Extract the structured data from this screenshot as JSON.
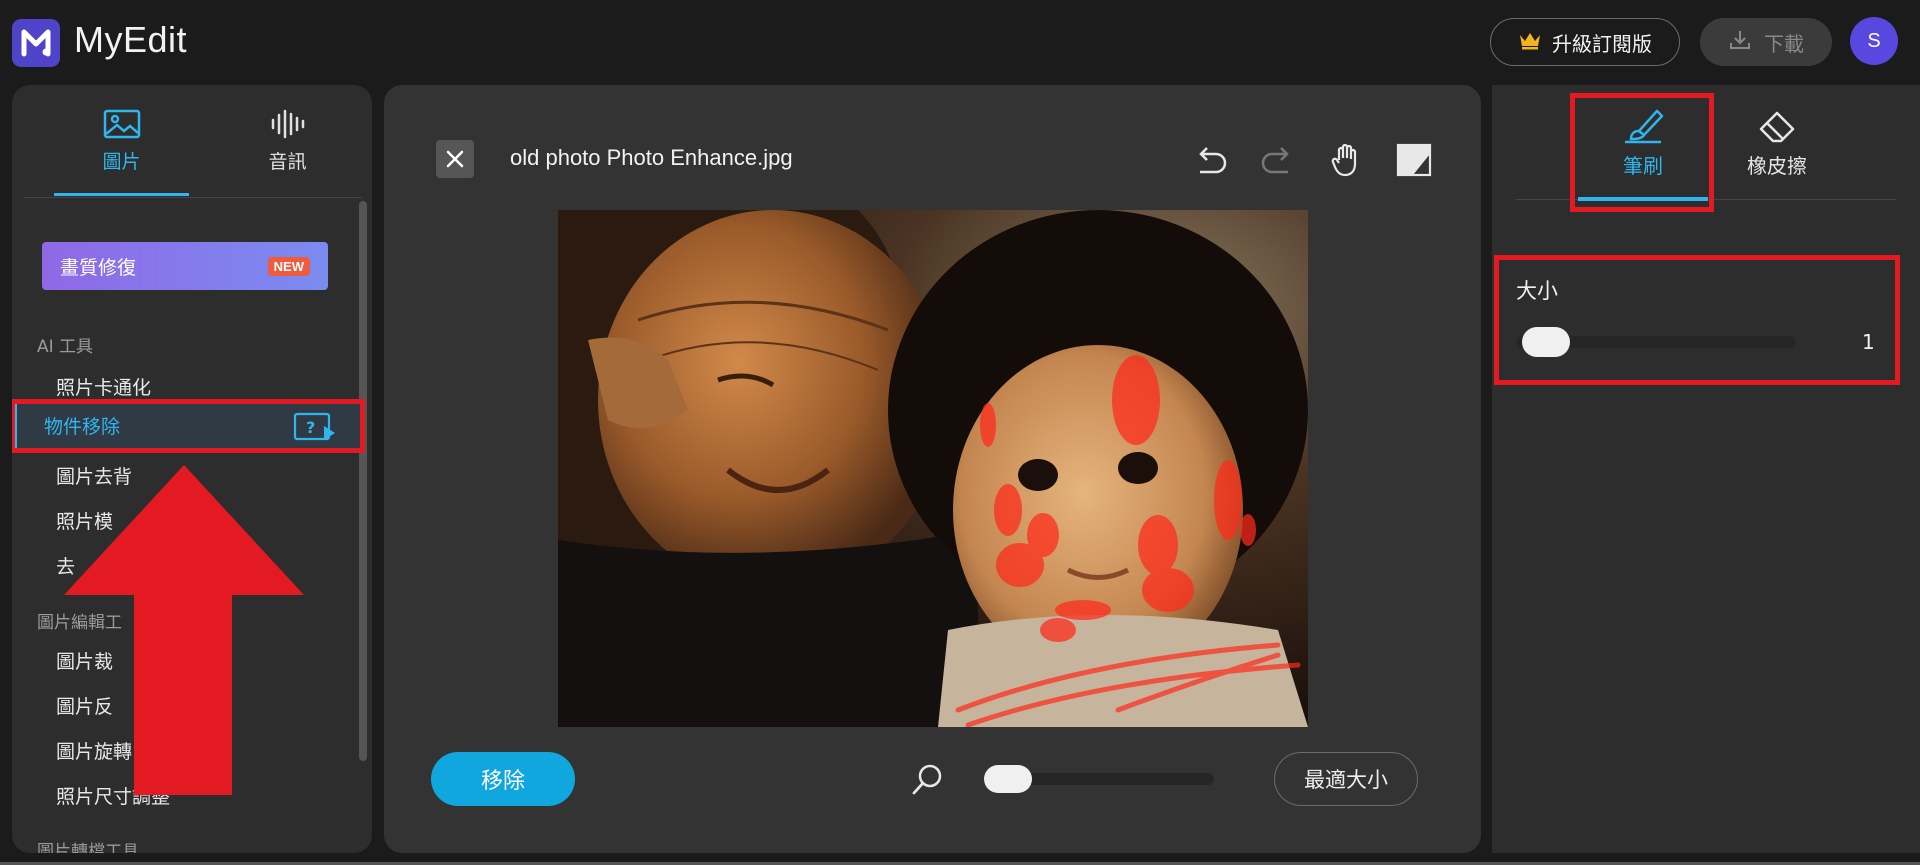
{
  "app": {
    "brand": "MyEdit"
  },
  "header": {
    "upgrade_label": "升級訂閱版",
    "download_label": "下載",
    "avatar_initial": "S"
  },
  "left": {
    "tabs": [
      {
        "label": "圖片",
        "icon": "image-icon",
        "active": true
      },
      {
        "label": "音訊",
        "icon": "waveform-icon",
        "active": false
      }
    ],
    "promo": {
      "label": "畫質修復",
      "badge": "NEW"
    },
    "sections": [
      {
        "title": "AI 工具",
        "items": [
          "照片卡通化",
          "物件移除",
          "圖片去背",
          "照片模",
          "去"
        ]
      },
      {
        "title": "圖片編輯工",
        "items": [
          "圖片裁",
          "圖片反",
          "圖片旋轉",
          "照片尺寸調整"
        ]
      },
      {
        "title": "圖片轉檔工具",
        "items": []
      }
    ],
    "active_item": "物件移除"
  },
  "canvas": {
    "file_name": "old photo Photo Enhance.jpg",
    "remove_label": "移除",
    "fit_label": "最適大小",
    "zoom_level": 0.05
  },
  "right": {
    "tabs": [
      {
        "label": "筆刷",
        "icon": "brush-icon",
        "active": true
      },
      {
        "label": "橡皮擦",
        "icon": "eraser-icon",
        "active": false
      }
    ],
    "size_label": "大小",
    "size_value": "1",
    "size_level": 0
  },
  "colors": {
    "accent": "#2fb6ee",
    "annotation_red": "#e41a22",
    "brand_purple": "#4f43c9",
    "remove_button": "#10a7df"
  }
}
